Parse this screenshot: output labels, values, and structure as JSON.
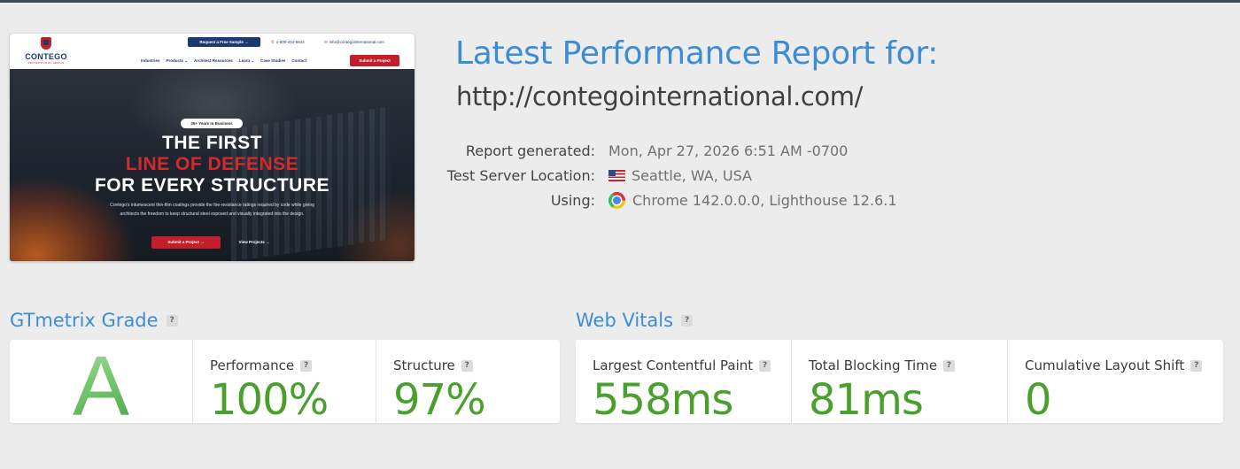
{
  "thumbnail": {
    "logo_text": "CONTEGO",
    "logo_tagline": "PROTECTION BY DESIGN",
    "sample_button": "Request a Free Sample →",
    "phone": "1-800-434-6644",
    "email": "info@contegointernational.com",
    "nav": [
      "Industries",
      "Products ⌄",
      "Architect Resources",
      "Learn ⌄",
      "Case Studies",
      "Contact"
    ],
    "nav_submit": "Submit a Project",
    "hero_pill": "25+ Years In Business",
    "hero_line1": "THE FIRST",
    "hero_line2": "LINE OF DEFENSE",
    "hero_line3": "FOR EVERY STRUCTURE",
    "hero_desc": "Contego's intumescent thin-film coatings provide the fire-resistance ratings required by code while giving architects the freedom to keep structural steel exposed and visually integrated into the design.",
    "hero_submit": "Submit a Project →",
    "hero_view": "View Projects →"
  },
  "report": {
    "title": "Latest Performance Report for:",
    "url": "http://contegointernational.com/",
    "generated_label": "Report generated:",
    "generated_value": "Mon, Apr 27, 2026 6:51 AM -0700",
    "location_label": "Test Server Location:",
    "location_value": "Seattle, WA, USA",
    "using_label": "Using:",
    "using_value": "Chrome 142.0.0.0, Lighthouse 12.6.1"
  },
  "grade": {
    "title": "GTmetrix Grade",
    "letter": "A",
    "performance_label": "Performance",
    "performance_value": "100%",
    "structure_label": "Structure",
    "structure_value": "97%"
  },
  "vitals": {
    "title": "Web Vitals",
    "lcp_label": "Largest Contentful Paint",
    "lcp_value": "558ms",
    "tbt_label": "Total Blocking Time",
    "tbt_value": "81ms",
    "cls_label": "Cumulative Layout Shift",
    "cls_value": "0"
  },
  "help_glyph": "?",
  "colors": {
    "title_blue": "#3d8cd6",
    "value_green": "#4aa02c",
    "page_bg": "#ececec"
  }
}
